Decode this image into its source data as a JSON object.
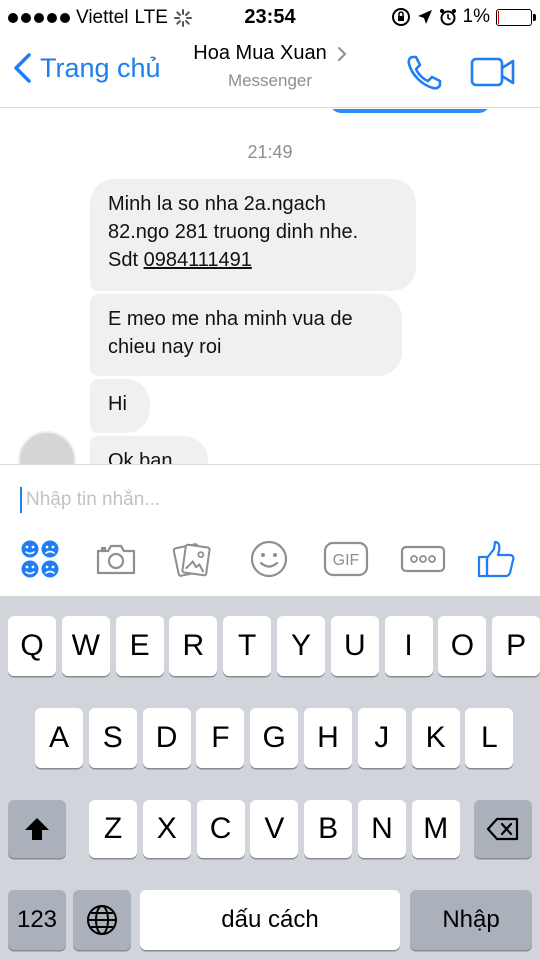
{
  "status": {
    "carrier": "Viettel",
    "network": "LTE",
    "time": "23:54",
    "battery_percent_text": "1%",
    "battery_level": 0.01
  },
  "header": {
    "back_label": "Trang chủ",
    "contact_name": "Hoa Mua Xuan",
    "subtitle": "Messenger"
  },
  "conversation": {
    "timestamp": "21:49",
    "messages": [
      {
        "lines": [
          "Minh la so nha 2a.ngach",
          "82.ngo 281 truong dinh nhe."
        ],
        "prefix": "Sdt ",
        "phone": "0984111491"
      },
      {
        "lines": [
          "E meo me nha minh vua de",
          "chieu nay roi"
        ]
      },
      {
        "lines": [
          "Hi"
        ]
      },
      {
        "lines": [
          "Ok ban"
        ]
      }
    ]
  },
  "composer": {
    "placeholder": "Nhập tin nhắn...",
    "value": "",
    "gif_label": "GIF"
  },
  "keyboard": {
    "row1": [
      "Q",
      "W",
      "E",
      "R",
      "T",
      "Y",
      "U",
      "I",
      "O",
      "P"
    ],
    "row2": [
      "A",
      "S",
      "D",
      "F",
      "G",
      "H",
      "J",
      "K",
      "L"
    ],
    "row3": [
      "Z",
      "X",
      "C",
      "V",
      "B",
      "N",
      "M"
    ],
    "numbers_label": "123",
    "space_label": "dấu cách",
    "return_label": "Nhập"
  },
  "colors": {
    "accent": "#1e7ef2",
    "bubble": "#f0f0f0",
    "keyboard_bg": "#d1d5db",
    "battery_low": "#dd0000"
  }
}
